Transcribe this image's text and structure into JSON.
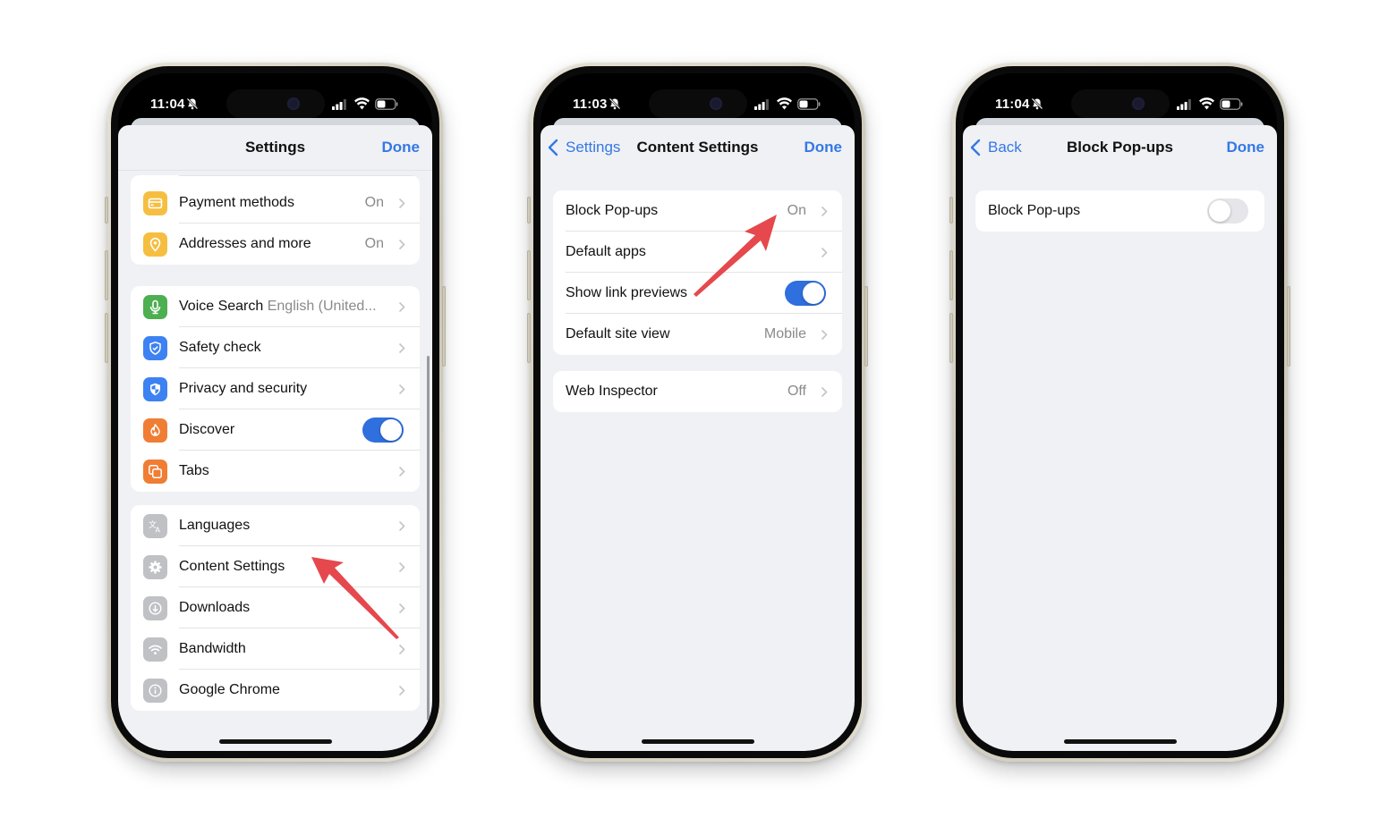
{
  "colors": {
    "accent_blue": "#3478e6",
    "toggle_on": "#2f6fde",
    "annotation_red": "#e5484d",
    "sheet_bg": "#f0f1f4",
    "icon_yellow": "#f6be41",
    "icon_green": "#4caf50",
    "icon_blue": "#3d82f2",
    "icon_orange": "#f07d34",
    "icon_gray": "#c0c1c5"
  },
  "phones": [
    {
      "status": {
        "time": "11:04",
        "icons": [
          "bell-slash-icon",
          "signal-icon",
          "wifi-icon",
          "battery-icon"
        ]
      },
      "nav": {
        "title": "Settings",
        "done": "Done"
      },
      "groups": [
        {
          "rows": [
            {
              "label": "Payment methods",
              "value": "On",
              "icon": "credit-card-icon",
              "chevron": true
            },
            {
              "label": "Addresses and more",
              "value": "On",
              "icon": "location-pin-icon",
              "chevron": true
            }
          ]
        },
        {
          "rows": [
            {
              "label": "Voice Search",
              "sublabel": "English (United...",
              "icon": "microphone-icon",
              "chevron": true
            },
            {
              "label": "Safety check",
              "icon": "shield-check-icon",
              "chevron": true
            },
            {
              "label": "Privacy and security",
              "icon": "shield-icon",
              "chevron": true
            },
            {
              "label": "Discover",
              "icon": "flame-icon",
              "toggle": true,
              "toggle_on": true
            },
            {
              "label": "Tabs",
              "icon": "tabs-icon",
              "chevron": true
            }
          ]
        },
        {
          "rows": [
            {
              "label": "Languages",
              "icon": "translate-icon",
              "chevron": true
            },
            {
              "label": "Content Settings",
              "icon": "gear-icon",
              "chevron": true
            },
            {
              "label": "Downloads",
              "icon": "download-icon",
              "chevron": true
            },
            {
              "label": "Bandwidth",
              "icon": "wifi-icon",
              "chevron": true
            },
            {
              "label": "Google Chrome",
              "icon": "info-icon",
              "chevron": true
            }
          ]
        }
      ]
    },
    {
      "status": {
        "time": "11:03",
        "icons": [
          "bell-slash-icon",
          "signal-icon",
          "wifi-icon",
          "battery-icon"
        ]
      },
      "nav": {
        "back": "Settings",
        "title": "Content Settings",
        "done": "Done"
      },
      "groups": [
        {
          "rows": [
            {
              "label": "Block Pop-ups",
              "value": "On",
              "chevron": true
            },
            {
              "label": "Default apps",
              "chevron": true
            },
            {
              "label": "Show link previews",
              "toggle": true,
              "toggle_on": true
            },
            {
              "label": "Default site view",
              "value": "Mobile",
              "chevron": true
            }
          ]
        },
        {
          "rows": [
            {
              "label": "Web Inspector",
              "value": "Off",
              "chevron": true
            }
          ]
        }
      ]
    },
    {
      "status": {
        "time": "11:04",
        "icons": [
          "bell-slash-icon",
          "signal-icon",
          "wifi-icon",
          "battery-icon"
        ]
      },
      "nav": {
        "back": "Back",
        "title": "Block Pop-ups",
        "done": "Done"
      },
      "groups": [
        {
          "rows": [
            {
              "label": "Block Pop-ups",
              "toggle": true,
              "toggle_on": false
            }
          ]
        }
      ]
    }
  ],
  "annotations": [
    {
      "type": "arrow",
      "points_to": "Content Settings",
      "phone": 1
    },
    {
      "type": "arrow",
      "points_to": "Block Pop-ups value On",
      "phone": 2
    }
  ]
}
